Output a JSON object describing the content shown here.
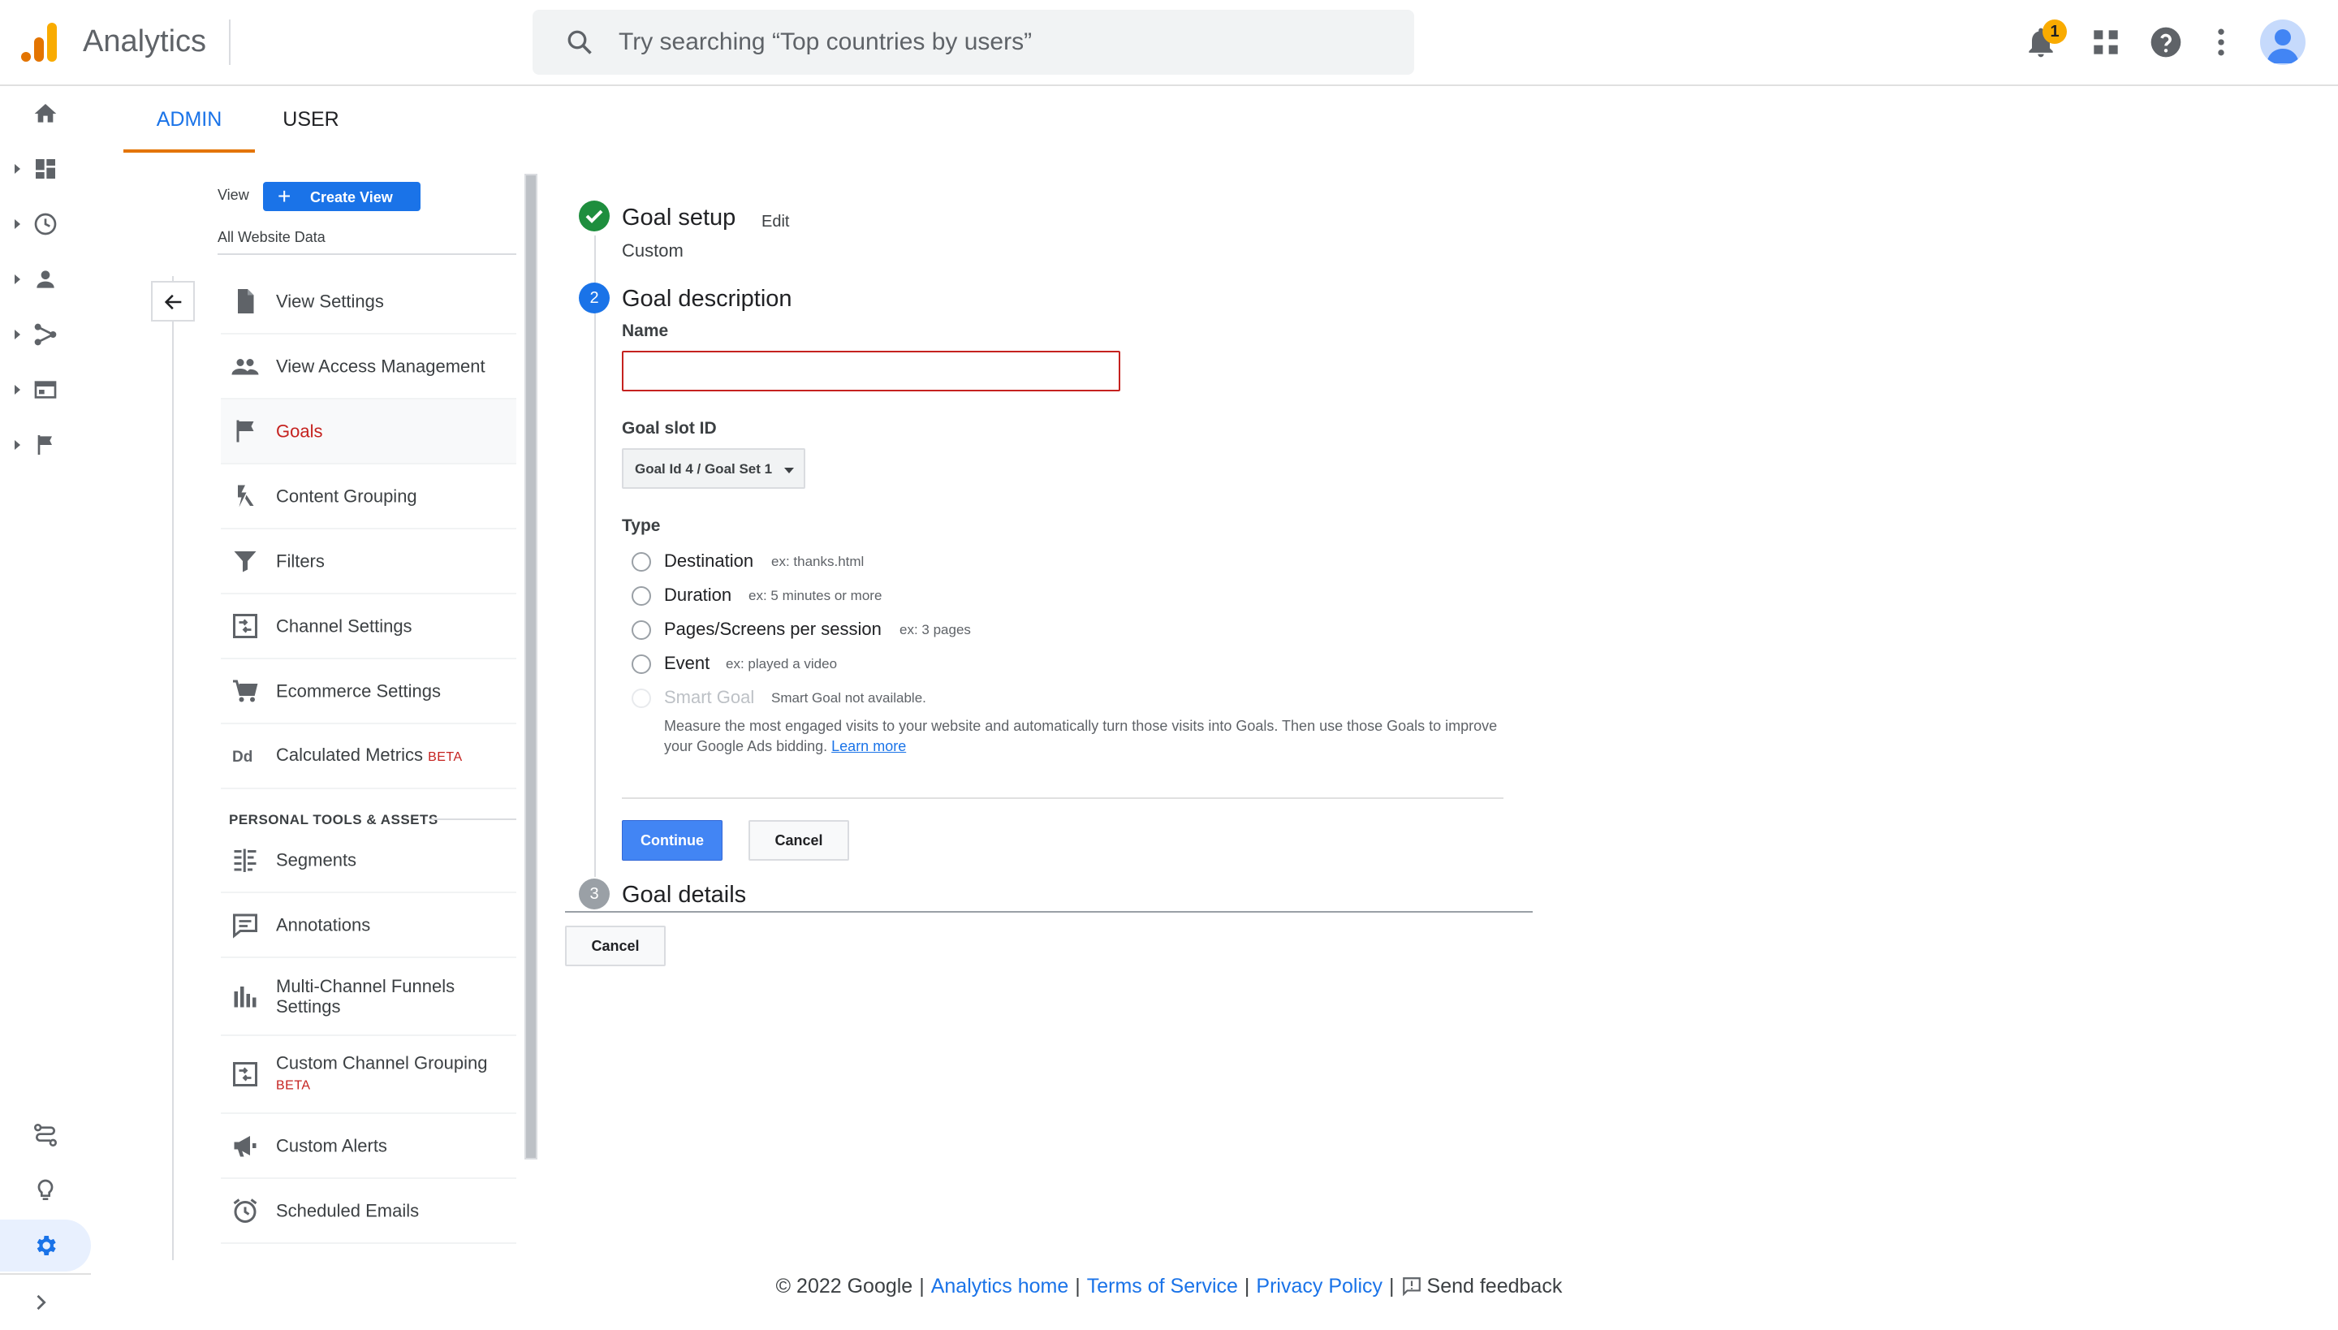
{
  "header": {
    "app_title": "Analytics",
    "search_placeholder": "Try searching “Top countries by users”",
    "notification_count": "1",
    "icons": [
      "bell-icon",
      "apps-grid-icon",
      "help-icon",
      "more-vert-icon",
      "account-avatar"
    ]
  },
  "rail": {
    "items": [
      "home-icon",
      "dashboard-icon",
      "realtime-clock-icon",
      "audience-person-icon",
      "acquisition-icon",
      "behavior-icon",
      "conversions-flag-icon"
    ],
    "bottom": [
      "attribution-icon",
      "discover-lightbulb-icon",
      "admin-gear-icon",
      "expand-chevron-icon"
    ]
  },
  "tabs": {
    "admin": "ADMIN",
    "user": "USER"
  },
  "view_column": {
    "view_label": "View",
    "create_view": "Create View",
    "view_name": "All Website Data",
    "items": [
      {
        "label": "View Settings",
        "icon": "document-icon"
      },
      {
        "label": "View Access Management",
        "icon": "people-icon"
      },
      {
        "label": "Goals",
        "icon": "flag-icon"
      },
      {
        "label": "Content Grouping",
        "icon": "content-grouping-icon"
      },
      {
        "label": "Filters",
        "icon": "filter-icon"
      },
      {
        "label": "Channel Settings",
        "icon": "channel-icon"
      },
      {
        "label": "Ecommerce Settings",
        "icon": "cart-icon"
      },
      {
        "label": "Calculated Metrics",
        "icon": "dd-icon",
        "badge": "BETA"
      }
    ],
    "section_title": "PERSONAL TOOLS & ASSETS",
    "personal_items": [
      {
        "label": "Segments",
        "icon": "segments-icon"
      },
      {
        "label": "Annotations",
        "icon": "annotation-icon"
      },
      {
        "label": "Multi-Channel Funnels",
        "label2": "Settings",
        "icon": "bar-chart-icon"
      },
      {
        "label": "Custom Channel Grouping",
        "badge": "BETA",
        "icon": "channel-icon"
      },
      {
        "label": "Custom Alerts",
        "icon": "megaphone-icon"
      },
      {
        "label": "Scheduled Emails",
        "icon": "alarm-clock-icon"
      }
    ]
  },
  "goal_form": {
    "step1": {
      "title": "Goal setup",
      "edit": "Edit",
      "value": "Custom"
    },
    "step2": {
      "num": "2",
      "title": "Goal description",
      "name_label": "Name",
      "name_value": "",
      "slot_label": "Goal slot ID",
      "slot_value": "Goal Id 4 / Goal Set 1",
      "type_label": "Type",
      "types": [
        {
          "label": "Destination",
          "hint": "ex: thanks.html"
        },
        {
          "label": "Duration",
          "hint": "ex: 5 minutes or more"
        },
        {
          "label": "Pages/Screens per session",
          "hint": "ex: 3 pages"
        },
        {
          "label": "Event",
          "hint": "ex: played a video"
        },
        {
          "label": "Smart Goal",
          "hint": "Smart Goal not available."
        }
      ],
      "smart_desc": "Measure the most engaged visits to your website and automatically turn those visits into Goals. Then use those Goals to improve your Google Ads bidding.",
      "learn_more": "Learn more",
      "continue": "Continue",
      "cancel": "Cancel"
    },
    "step3": {
      "num": "3",
      "title": "Goal details"
    },
    "cancel": "Cancel"
  },
  "footer": {
    "copyright": "© 2022 Google",
    "analytics_home": "Analytics home",
    "terms": "Terms of Service",
    "privacy": "Privacy Policy",
    "feedback": "Send feedback"
  },
  "colors": {
    "accent": "#1a73e8",
    "active_red": "#c5221f",
    "tab_underline": "#e37400",
    "success": "#1e8e3e"
  }
}
